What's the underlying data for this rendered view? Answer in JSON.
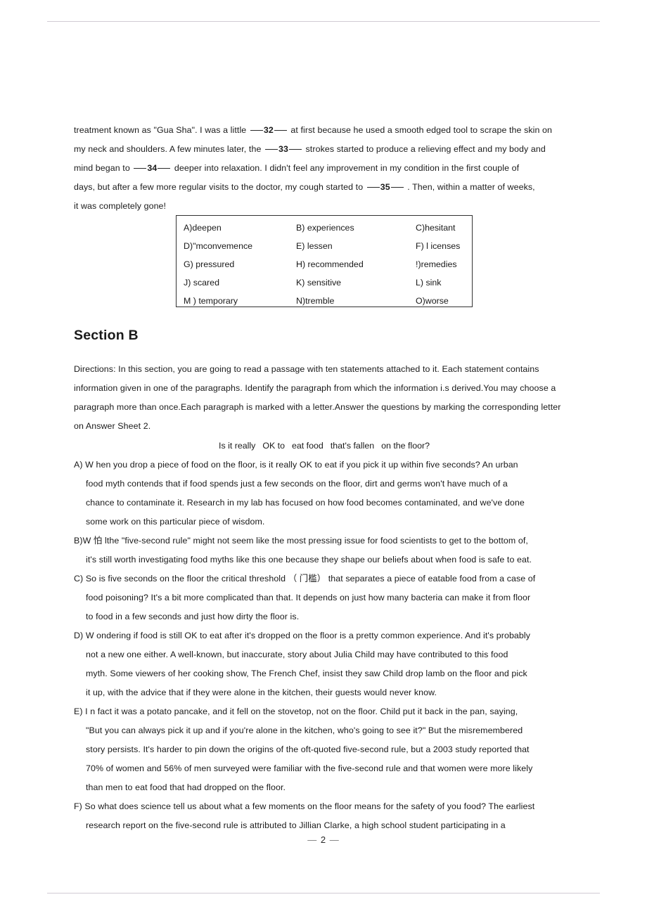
{
  "page": {
    "number": "2",
    "number_left_dash": "—",
    "number_right_dash": "—"
  },
  "cloze": {
    "lines": [
      {
        "segments": [
          {
            "text": "treatment  known as \"Gua Sha\". I was a little"
          },
          {
            "blank": "32"
          },
          {
            "text": "at first because he used a smooth edged tool to scrape the skin on"
          }
        ]
      },
      {
        "segments": [
          {
            "text": "my  neck  and shoulders.   A few minutes later,"
          },
          {
            "text": "the"
          },
          {
            "blank": "33"
          },
          {
            "text": "strokes started to produce a relieving effect and my body and"
          }
        ]
      },
      {
        "segments": [
          {
            "text": "mind began to"
          },
          {
            "blank": "34"
          },
          {
            "text": "deeper  into   relaxation.   I  didn't   feel  any improvement   in  my  condition   in  the  first  couple  of"
          }
        ]
      },
      {
        "segments": [
          {
            "text": "days,   but  after a  few more regular visits to the doctor,"
          },
          {
            "text": "my cough started to"
          },
          {
            "blank": "35"
          },
          {
            "text": ". Then,   within a matter of weeks,"
          }
        ]
      },
      {
        "segments": [
          {
            "text": "it  was  completely   gone!"
          }
        ]
      }
    ]
  },
  "word_bank": {
    "rows": [
      [
        "A)deepen",
        "B) experiences",
        "C)hesitant"
      ],
      [
        "D)\"mconvemence",
        "E) lessen",
        "F) l icenses"
      ],
      [
        "G)  pressured",
        "H) recommended",
        "!)remedies"
      ],
      [
        "J) scared",
        "K) sensitive",
        "L) sink"
      ],
      [
        "M ) temporary",
        "N)tremble",
        "O)worse"
      ]
    ]
  },
  "section": {
    "heading": "Section B",
    "directions_lines": [
      "Directions: In this section,      you are  going  to read  a  passage with  ten statements attached  to it. Each  statement contains",
      "information   given in one  of the paragraphs. Identify the paragraph from which the information       i.s derived.You may choose a",
      "paragraph  more than once.Each paragraph is marked with a letter.Answer the questions     by marking the corresponding letter",
      "on Answer   Sheet 2."
    ],
    "passage_title_parts": [
      "Is it really",
      "OK to",
      "eat food",
      "that's fallen",
      "on the floor?"
    ]
  },
  "passage": {
    "paragraphs": [
      {
        "label": "A)",
        "lines": [
          "A) W hen you  drop a piece   of  food  on the floor,    is it really OK to eat if you pick it up within five seconds? An urban",
          "food  myth  contends that  if  food  spends just   a few   seconds on  the floor,    dirt  and germs won't   have much  of  a",
          "chance to  contaminate  it. Research in  my  lab  has focused  on how  food  becomes contaminated,   and we've  done",
          "some work   on this particular piece    of  wisdom."
        ]
      },
      {
        "label": "B)",
        "lines": [
          "B)W  怕  lthe  \"five-second rule\" might not seem like the most pressing issue for food scientists to get to the bottom of,",
          "it's  still  worth investigating food myths like this one because they shape our beliefs        about  when food is safe to eat."
        ]
      },
      {
        "label": "C)",
        "lines": [
          "C) So is five seconds   on the floor the critical threshold      （ 门槛）  that  separates a  piece  of  eatable food   from  a  case of",
          "food poisoning? It's a bit more complicated than that. It depends on just how many bacteria can make it from floor",
          "to food in a   few  seconds and just how dirty    the floor   is."
        ]
      },
      {
        "label": "D)",
        "lines": [
          "D) W ondering if food is still OK to eat after it's dropped on the floor is a pretty common experience.           And it's probably",
          "not a new  one either. A  well-known,    but  inaccurate,   story  about  Julia  Child   may  have  contributed  to  this  food",
          "myth.  Some  viewers  of  her cooking show,     The French  Chef,  insist they saw Child drop lamb on the floor and pick",
          "it  up,  with  the advice that   if they were alone   in the kitchen,    their  guests would   never  know."
        ]
      },
      {
        "label": "E)",
        "lines": [
          "E) I n fact  it  was a potato  pancake,  and it fell on the stovetop,    not on the floor.    Child put it back in the pan,     saying,",
          "\"But you    can always pick it up and if you're alone in the kitchen,         who's going to see it?\" But the misremembered",
          "story  persists. It's   harder  to pin down the origins of the oft-quoted five-second rule,       but a 2003 study reported that",
          "70%  of women and 56%    of men surveyed were familiar with the five-second rule and that women were more likely",
          "than men to eat food that had dropped      on the floor."
        ]
      },
      {
        "label": "F)",
        "lines": [
          "F) So  what does science tell us about what a few moments on the floor means for the safety of you food? The earliest",
          "research report  on  the  five-second  rule  is  attributed  to  Jillian   Clarke,   a  high  school  student  participating   in  a"
        ]
      }
    ]
  }
}
